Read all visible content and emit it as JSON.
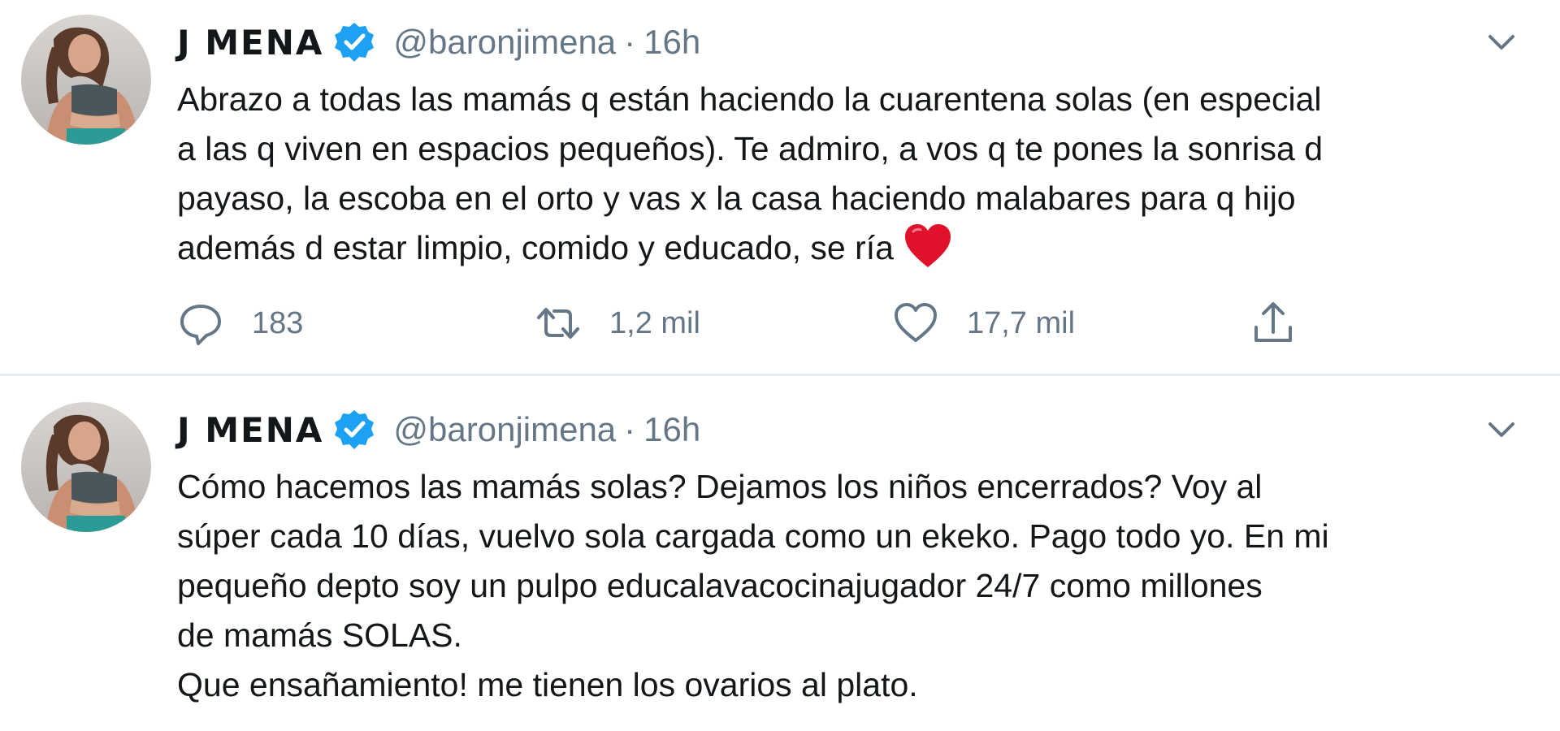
{
  "tweets": [
    {
      "author": {
        "display_name": "J MENA",
        "handle": "@baronjimena",
        "verified": true
      },
      "separator": "·",
      "timestamp": "16h",
      "text_lines": [
        "Abrazo a todas las mamás q están haciendo la cuarentena solas (en especial",
        "a las q viven en espacios pequeños). Te admiro, a vos q te pones la sonrisa d",
        "payaso, la escoba en el orto y vas x la casa haciendo malabares para q hijo",
        "además d estar limpio, comido y educado, se ría"
      ],
      "emoji": "heart-emoji",
      "actions": {
        "replies": "183",
        "retweets": "1,2 mil",
        "likes": "17,7 mil"
      }
    },
    {
      "author": {
        "display_name": "J MENA",
        "handle": "@baronjimena",
        "verified": true
      },
      "separator": "·",
      "timestamp": "16h",
      "text_lines": [
        "Cómo hacemos las mamás solas? Dejamos los niños encerrados? Voy al",
        "súper cada 10 días, vuelvo sola cargada como un ekeko. Pago todo yo. En mi",
        "pequeño depto soy un pulpo educalavacocinajugador 24/7 como millones",
        "de mamás SOLAS.",
        "Que ensañamiento! me tienen los ovarios al plato."
      ]
    }
  ],
  "icons": {
    "verified": "verified-badge-icon",
    "caret": "chevron-down-icon",
    "reply": "reply-icon",
    "retweet": "retweet-icon",
    "like": "heart-outline-icon",
    "share": "share-icon"
  },
  "colors": {
    "text": "#14171a",
    "secondary": "#657786",
    "verified": "#1da1f2",
    "divider": "#e6ecf0",
    "heart": "#e0112b"
  }
}
